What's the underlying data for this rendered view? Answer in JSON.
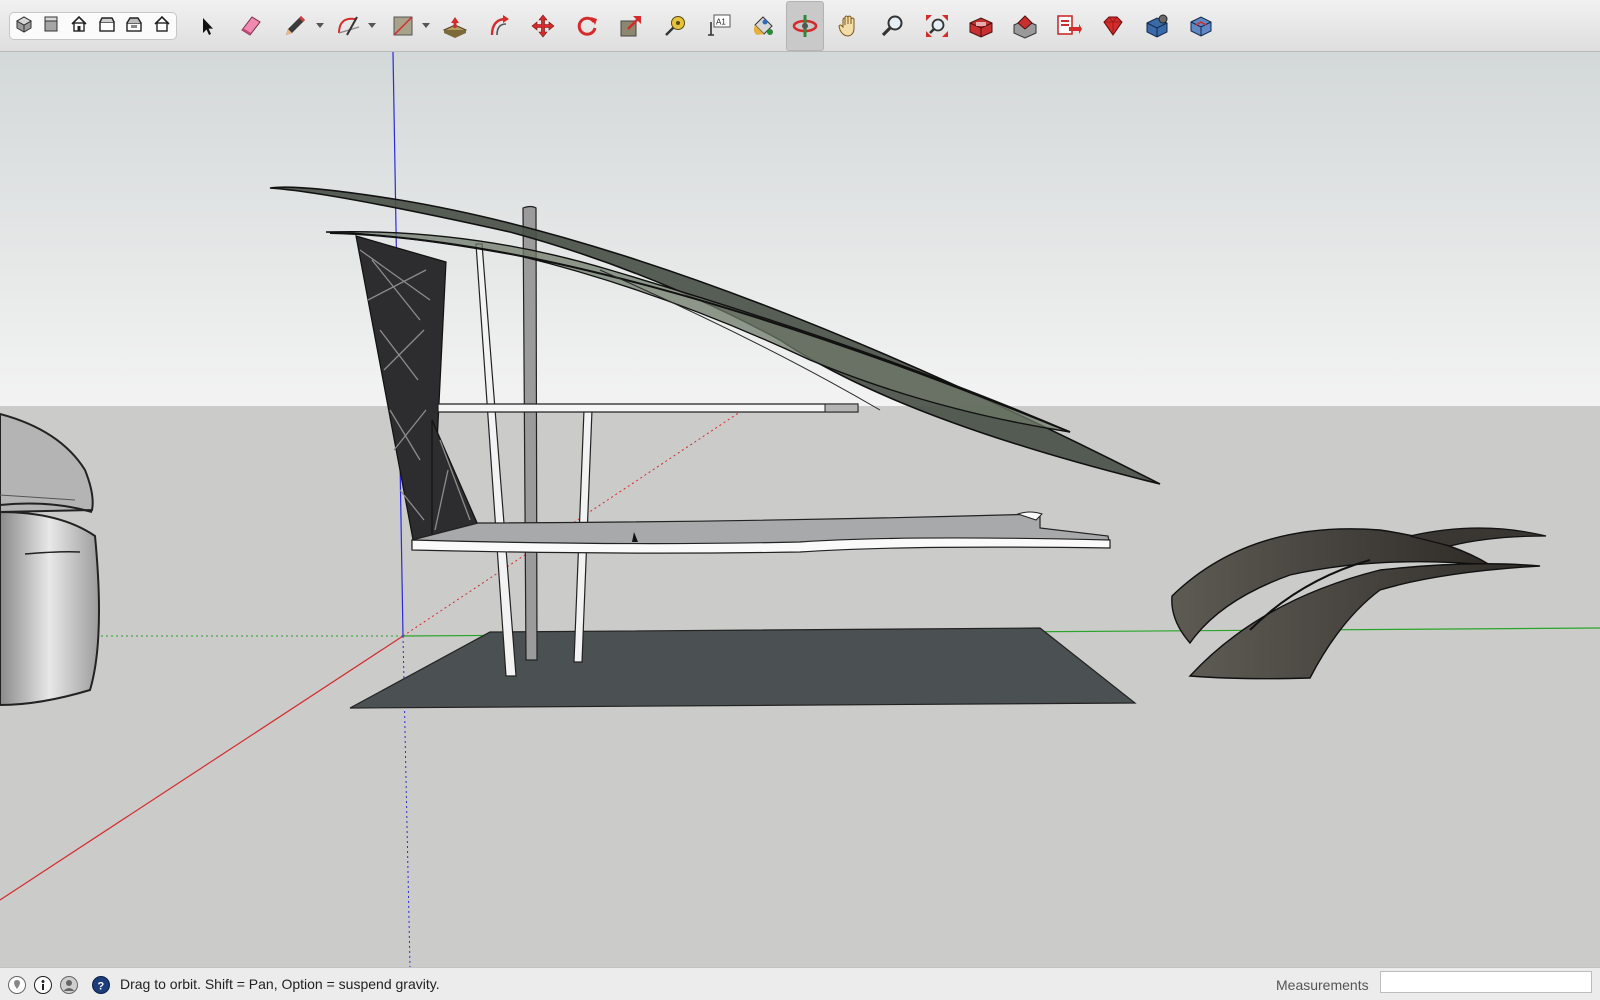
{
  "toolbar": {
    "views": [
      {
        "name": "iso-view-icon"
      },
      {
        "name": "top-view-icon"
      },
      {
        "name": "front-view-icon"
      },
      {
        "name": "right-view-icon"
      },
      {
        "name": "back-view-icon"
      },
      {
        "name": "left-view-icon"
      }
    ],
    "tools": [
      {
        "name": "select-tool",
        "icon": "arrow-icon"
      },
      {
        "name": "eraser-tool",
        "icon": "eraser-icon"
      },
      {
        "name": "line-tool",
        "icon": "pencil-icon",
        "dropdown": true
      },
      {
        "name": "arc-tool",
        "icon": "arc-icon",
        "dropdown": true
      },
      {
        "name": "rectangle-tool",
        "icon": "rectangle-icon",
        "dropdown": true
      },
      {
        "name": "push-pull-tool",
        "icon": "push-pull-icon"
      },
      {
        "name": "offset-tool",
        "icon": "offset-icon"
      },
      {
        "name": "move-tool",
        "icon": "move-icon"
      },
      {
        "name": "rotate-tool",
        "icon": "rotate-icon"
      },
      {
        "name": "scale-tool",
        "icon": "scale-icon"
      },
      {
        "name": "tape-measure-tool",
        "icon": "tape-measure-icon"
      },
      {
        "name": "text-tool",
        "icon": "text-icon",
        "label": "A1"
      },
      {
        "name": "paint-bucket-tool",
        "icon": "paint-bucket-icon"
      },
      {
        "name": "orbit-tool",
        "icon": "orbit-icon",
        "active": true
      },
      {
        "name": "pan-tool",
        "icon": "hand-icon"
      },
      {
        "name": "zoom-tool",
        "icon": "magnifier-icon"
      },
      {
        "name": "zoom-extents-tool",
        "icon": "zoom-extents-icon"
      },
      {
        "name": "warehouse-tool",
        "icon": "warehouse-icon"
      },
      {
        "name": "share-model-tool",
        "icon": "share-model-icon"
      },
      {
        "name": "send-to-layout-tool",
        "icon": "layout-icon"
      },
      {
        "name": "extension-warehouse-tool",
        "icon": "ruby-icon"
      },
      {
        "name": "extension-manager-tool",
        "icon": "extension-manager-icon"
      },
      {
        "name": "components-tool",
        "icon": "component-icon"
      }
    ]
  },
  "statusbar": {
    "hint": "Drag to orbit. Shift = Pan, Option = suspend gravity.",
    "measurements_label": "Measurements",
    "measurements_value": ""
  },
  "colors": {
    "sky_top": "#d3d8d8",
    "sky_bottom": "#f2f2f2",
    "ground": "#cbcbca",
    "axis_red": "#d52b2b",
    "axis_green": "#2aa52a",
    "axis_blue": "#2b2bd8",
    "canopy": "#4a5148",
    "accent_red": "#d62b2b"
  }
}
